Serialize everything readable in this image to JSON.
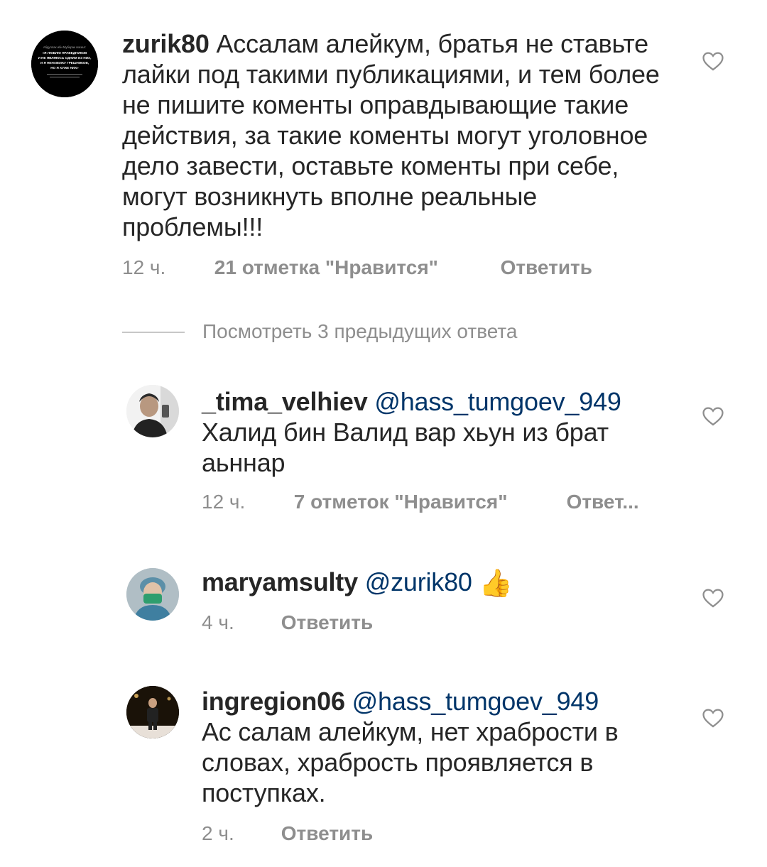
{
  "comments": [
    {
      "username": "zurik80",
      "mention": "",
      "text": "Ассалам алейкум, братья не ставьте лайки под такими публикациями, и тем более не пишите коменты оправдывающие такие действия, за такие коменты могут уголовное дело завести,  оставьте коменты при себе, могут возникнуть вполне реальные проблемы!!!",
      "time": "12 ч.",
      "likes": "21 отметка \"Нравится\"",
      "reply": "Ответить",
      "avatar_text": [
        "Абдуллах ибн Мубарак сказал:",
        "«Я ЛЮБЛЮ ПРАВЕДНИКОВ",
        "И НЕ ЯВЛЯЮСЬ ОДНИМ ИЗ НИХ,",
        "И Я НЕНАВИЖУ ГРЕШНИКОВ,",
        "НО Я ХУЖЕ НИХ»"
      ]
    },
    {
      "username": "_tima_velhiev",
      "mention": "@hass_tumgoev_949",
      "text": "Халид бин Валид вар хьун из брат аьннар",
      "time": "12 ч.",
      "likes": "7 отметок \"Нравится\"",
      "reply": "Ответ..."
    },
    {
      "username": "maryamsulty",
      "mention": "@zurik80",
      "emoji": "👍",
      "text": "",
      "time": "4 ч.",
      "reply": "Ответить"
    },
    {
      "username": "ingregion06",
      "mention": "@hass_tumgoev_949",
      "text": "Ас салам алейкум, нет храбрости в словах, храбрость проявляется в поступках.",
      "time": "2 ч.",
      "reply": "Ответить"
    }
  ],
  "view_previous": "Посмотреть 3 предыдущих ответа",
  "colors": {
    "text": "#262626",
    "meta": "#8e8e8e",
    "mention": "#003569",
    "divider": "#c7c7c7"
  },
  "icons": {
    "heart": "heart-outline-icon",
    "thumbs_up": "thumbs-up-emoji"
  }
}
